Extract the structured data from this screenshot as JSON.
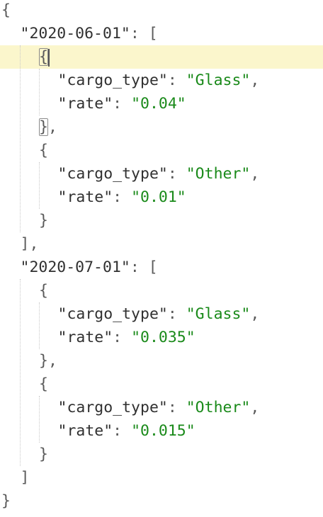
{
  "editor": {
    "lines": [
      {
        "indent": 0,
        "tokens": [
          {
            "t": "punc",
            "v": "{"
          }
        ]
      },
      {
        "indent": 1,
        "tokens": [
          {
            "t": "key",
            "v": "\"2020-06-01\""
          },
          {
            "t": "punc",
            "v": ": ["
          }
        ]
      },
      {
        "indent": 2,
        "current": true,
        "tokens": [
          {
            "t": "punc",
            "v": "{",
            "match": true
          }
        ],
        "caret": true
      },
      {
        "indent": 3,
        "tokens": [
          {
            "t": "key",
            "v": "\"cargo_type\""
          },
          {
            "t": "punc",
            "v": ": "
          },
          {
            "t": "str",
            "v": "\"Glass\""
          },
          {
            "t": "punc",
            "v": ","
          }
        ]
      },
      {
        "indent": 3,
        "tokens": [
          {
            "t": "key",
            "v": "\"rate\""
          },
          {
            "t": "punc",
            "v": ": "
          },
          {
            "t": "str",
            "v": "\"0.04\""
          }
        ]
      },
      {
        "indent": 2,
        "tokens": [
          {
            "t": "punc",
            "v": "}",
            "match": true
          },
          {
            "t": "punc",
            "v": ","
          }
        ]
      },
      {
        "indent": 2,
        "tokens": [
          {
            "t": "punc",
            "v": "{"
          }
        ]
      },
      {
        "indent": 3,
        "tokens": [
          {
            "t": "key",
            "v": "\"cargo_type\""
          },
          {
            "t": "punc",
            "v": ": "
          },
          {
            "t": "str",
            "v": "\"Other\""
          },
          {
            "t": "punc",
            "v": ","
          }
        ]
      },
      {
        "indent": 3,
        "tokens": [
          {
            "t": "key",
            "v": "\"rate\""
          },
          {
            "t": "punc",
            "v": ": "
          },
          {
            "t": "str",
            "v": "\"0.01\""
          }
        ]
      },
      {
        "indent": 2,
        "tokens": [
          {
            "t": "punc",
            "v": "}"
          }
        ]
      },
      {
        "indent": 1,
        "tokens": [
          {
            "t": "punc",
            "v": "],"
          }
        ]
      },
      {
        "indent": 1,
        "tokens": [
          {
            "t": "key",
            "v": "\"2020-07-01\""
          },
          {
            "t": "punc",
            "v": ": ["
          }
        ]
      },
      {
        "indent": 2,
        "tokens": [
          {
            "t": "punc",
            "v": "{"
          }
        ]
      },
      {
        "indent": 3,
        "tokens": [
          {
            "t": "key",
            "v": "\"cargo_type\""
          },
          {
            "t": "punc",
            "v": ": "
          },
          {
            "t": "str",
            "v": "\"Glass\""
          },
          {
            "t": "punc",
            "v": ","
          }
        ]
      },
      {
        "indent": 3,
        "tokens": [
          {
            "t": "key",
            "v": "\"rate\""
          },
          {
            "t": "punc",
            "v": ": "
          },
          {
            "t": "str",
            "v": "\"0.035\""
          }
        ]
      },
      {
        "indent": 2,
        "tokens": [
          {
            "t": "punc",
            "v": "},"
          }
        ]
      },
      {
        "indent": 2,
        "tokens": [
          {
            "t": "punc",
            "v": "{"
          }
        ]
      },
      {
        "indent": 3,
        "tokens": [
          {
            "t": "key",
            "v": "\"cargo_type\""
          },
          {
            "t": "punc",
            "v": ": "
          },
          {
            "t": "str",
            "v": "\"Other\""
          },
          {
            "t": "punc",
            "v": ","
          }
        ]
      },
      {
        "indent": 3,
        "tokens": [
          {
            "t": "key",
            "v": "\"rate\""
          },
          {
            "t": "punc",
            "v": ": "
          },
          {
            "t": "str",
            "v": "\"0.015\""
          }
        ]
      },
      {
        "indent": 2,
        "tokens": [
          {
            "t": "punc",
            "v": "}"
          }
        ]
      },
      {
        "indent": 1,
        "tokens": [
          {
            "t": "punc",
            "v": "]"
          }
        ]
      },
      {
        "indent": 0,
        "tokens": [
          {
            "t": "punc",
            "v": "}"
          }
        ]
      }
    ],
    "colors": {
      "string": "#1a8a1a",
      "key": "#303030",
      "current_line": "#fbf6cc"
    }
  }
}
